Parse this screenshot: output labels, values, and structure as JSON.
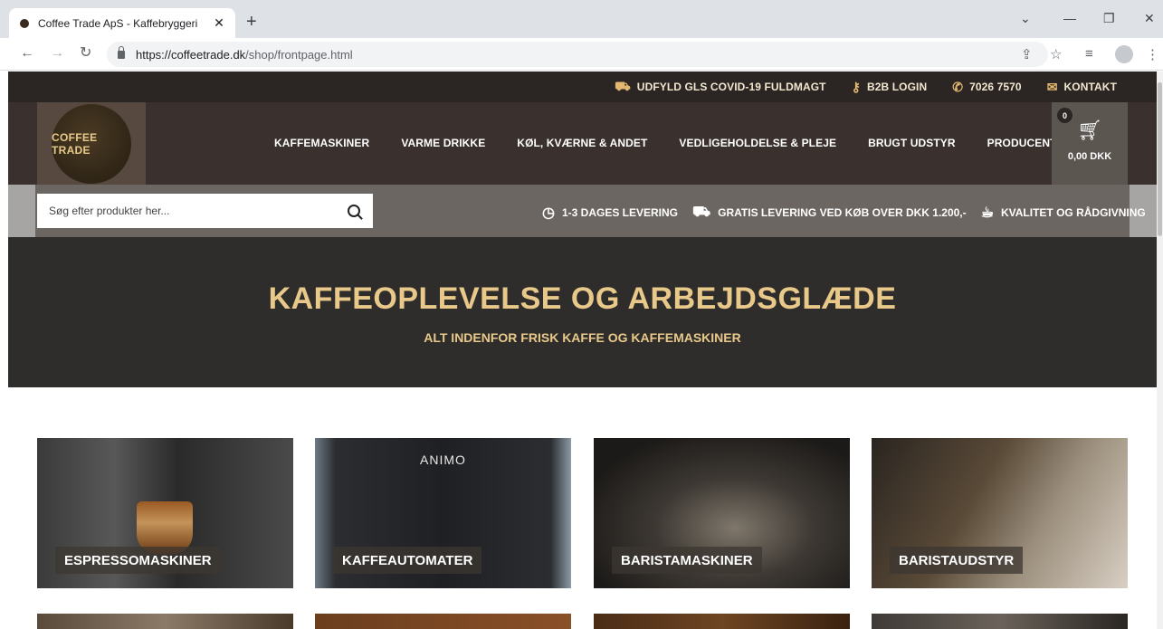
{
  "browser": {
    "tab_title": "Coffee Trade ApS - Kaffebryggeri",
    "tab_close": "✕",
    "new_tab": "+",
    "url_domain": "https://coffeetrade.dk",
    "url_path": "/shop/frontpage.html"
  },
  "topbar": {
    "items": [
      {
        "icon": "truck-icon",
        "label": "UDFYLD GLS COVID-19 FULDMAGT"
      },
      {
        "icon": "key-icon",
        "label": "B2B LOGIN"
      },
      {
        "icon": "phone-icon",
        "label": "7026 7570"
      },
      {
        "icon": "envelope-icon",
        "label": "KONTAKT"
      }
    ]
  },
  "header": {
    "logo_text": "COFFEE TRADE",
    "nav": [
      "KAFFEMASKINER",
      "VARME DRIKKE",
      "KØL, KVÆRNE & ANDET",
      "VEDLIGEHOLDELSE & PLEJE",
      "BRUGT UDSTYR",
      "PRODUCENT"
    ],
    "cart": {
      "count": "0",
      "total": "0,00 DKK"
    }
  },
  "search": {
    "placeholder": "Søg efter produkter her..."
  },
  "usp": [
    {
      "icon": "clock-icon",
      "label": "1-3 DAGES LEVERING"
    },
    {
      "icon": "truck-icon",
      "label": "GRATIS LEVERING VED KØB OVER DKK 1.200,-"
    },
    {
      "icon": "coffee-cup-icon",
      "label": "KVALITET OG RÅDGIVNING"
    }
  ],
  "hero": {
    "title": "KAFFEOPLEVELSE OG ARBEJDSGLÆDE",
    "subtitle": "ALT INDENFOR FRISK KAFFE OG KAFFEMASKINER"
  },
  "categories": [
    {
      "label": "ESPRESSOMASKINER"
    },
    {
      "label": "KAFFEAUTOMATER",
      "brand": "ANIMO"
    },
    {
      "label": "BARISTAMASKINER"
    },
    {
      "label": "BARISTAUDSTYR"
    }
  ]
}
